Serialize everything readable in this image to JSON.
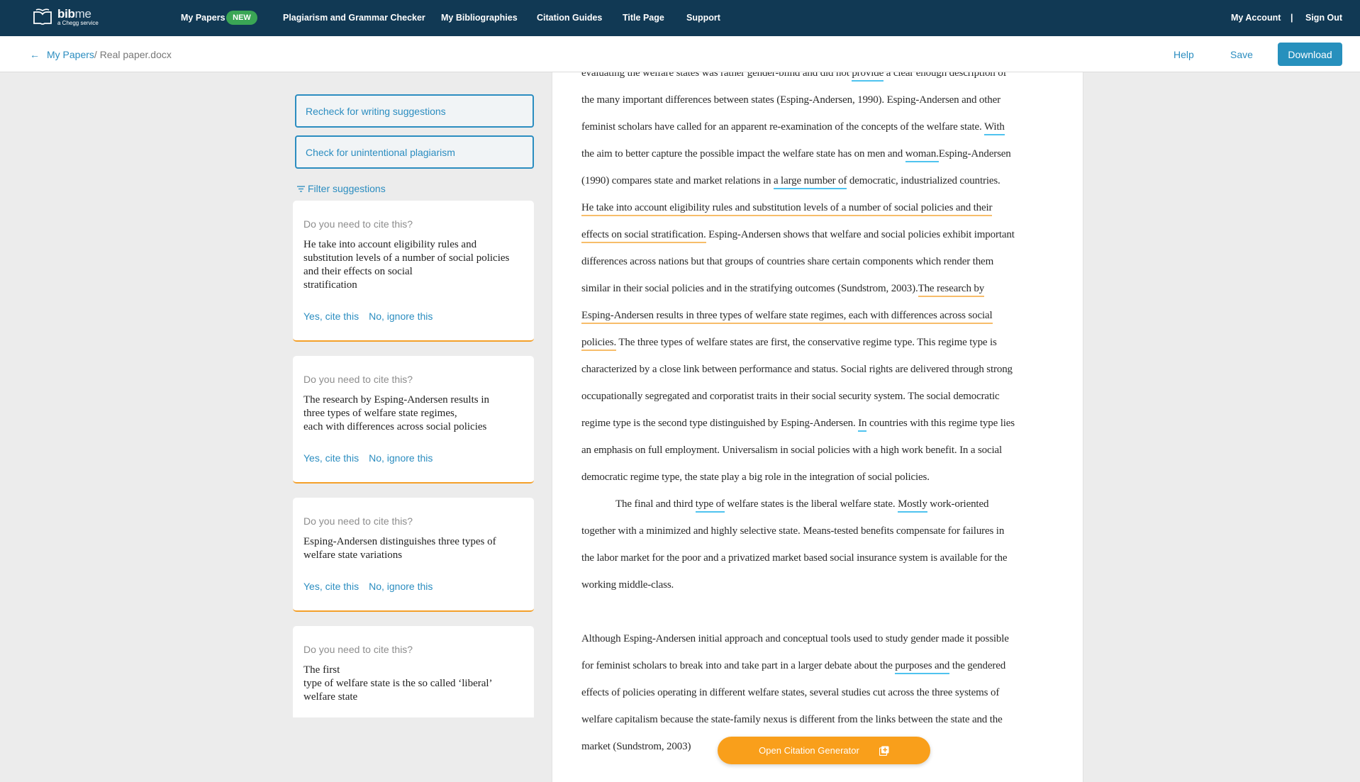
{
  "app": {
    "logo": {
      "name_bold": "bib",
      "name_light": "me",
      "tagline": "a Chegg service"
    },
    "nav": [
      {
        "label": "My Papers",
        "badge": "NEW"
      },
      {
        "label": "Plagiarism and Grammar Checker"
      },
      {
        "label": "My Bibliographies"
      },
      {
        "label": "Citation Guides"
      },
      {
        "label": "Title Page"
      },
      {
        "label": "Support"
      }
    ],
    "account": {
      "my_account": "My Account",
      "separator": "|",
      "sign_out": "Sign Out"
    }
  },
  "subheader": {
    "back_arrow": "←",
    "breadcrumb_link": "My Papers",
    "breadcrumb_current": "/ Real paper.docx",
    "help": "Help",
    "save": "Save",
    "download": "Download"
  },
  "sidebar": {
    "recheck_button": "Recheck for writing suggestions",
    "plagiarism_button": "Check for unintentional plagiarism",
    "filter_label": "Filter suggestions",
    "cards": [
      {
        "question": "Do you need to cite this?",
        "quote": "He take into account eligibility rules and\nsubstitution levels of a number of social policies\nand their effects on social\nstratification",
        "yes": "Yes, cite this",
        "no": "No, ignore this"
      },
      {
        "question": "Do you need to cite this?",
        "quote": "The research by Esping-Andersen results in\nthree types of welfare state regimes,\neach with differences across social policies",
        "yes": "Yes, cite this",
        "no": "No, ignore this"
      },
      {
        "question": "Do you need to cite this?",
        "quote": "Esping-Andersen distinguishes three types of\nwelfare state variations",
        "yes": "Yes, cite this",
        "no": "No, ignore this"
      },
      {
        "question": "Do you need to cite this?",
        "quote": "The first\ntype of welfare state is the so called ‘liberal’\nwelfare state"
      }
    ]
  },
  "document": {
    "lines": [
      {
        "segments": [
          {
            "t": "evaluating the welfare states was rather gender-blind and did not "
          },
          {
            "t": "provide",
            "u": "blue"
          },
          {
            "t": " a clear enough description of"
          }
        ]
      },
      {
        "segments": [
          {
            "t": "the many important differences between states (Esping-Andersen, 1990). Esping-Andersen and other"
          }
        ]
      },
      {
        "segments": [
          {
            "t": "feminist scholars have called for an apparent re-examination of the concepts of the welfare state. "
          },
          {
            "t": "With",
            "u": "blue"
          }
        ]
      },
      {
        "segments": [
          {
            "t": "the aim to better capture the possible impact the welfare state has on men and "
          },
          {
            "t": "woman.",
            "u": "blue"
          },
          {
            "t": "Esping-Andersen"
          }
        ]
      },
      {
        "segments": [
          {
            "t": "(1990) compares state and market relations in "
          },
          {
            "t": "a large number of",
            "u": "blue"
          },
          {
            "t": " democratic, industrialized countries."
          }
        ]
      },
      {
        "segments": [
          {
            "t": "He take into account eligibility rules and substitution levels of a number of social policies and their ",
            "u": "orange"
          }
        ]
      },
      {
        "segments": [
          {
            "t": "effects on social stratification.",
            "u": "orange"
          },
          {
            "t": " Esping-Andersen shows that welfare and social policies exhibit important"
          }
        ]
      },
      {
        "segments": [
          {
            "t": "differences across nations but that groups of countries share certain components which render them"
          }
        ]
      },
      {
        "segments": [
          {
            "t": "similar in their social policies and in the stratifying outcomes (Sundstrom, 2003)."
          },
          {
            "t": "The research by ",
            "u": "orange"
          }
        ]
      },
      {
        "segments": [
          {
            "t": "Esping-Andersen results in three types of welfare state regimes, each with differences across social ",
            "u": "orange"
          }
        ]
      },
      {
        "segments": [
          {
            "t": "policies.",
            "u": "orange"
          },
          {
            "t": " The three types of welfare states are first, the conservative regime type. This regime type is"
          }
        ]
      },
      {
        "segments": [
          {
            "t": "characterized by a close link between performance and status. Social rights are delivered through strong"
          }
        ]
      },
      {
        "segments": [
          {
            "t": "occupationally segregated and corporatist traits in their social security system. The social democratic"
          }
        ]
      },
      {
        "segments": [
          {
            "t": "regime type is the second type distinguished by Esping-Andersen. "
          },
          {
            "t": "In",
            "u": "blue"
          },
          {
            "t": " countries with this regime type lies"
          }
        ]
      },
      {
        "segments": [
          {
            "t": "an emphasis on full employment. Universalism in social policies with a high work benefit. In a social"
          }
        ]
      },
      {
        "segments": [
          {
            "t": "democratic regime type, the state play a big role in the integration of social policies."
          }
        ]
      },
      {
        "indent": true,
        "segments": [
          {
            "t": "The final and third "
          },
          {
            "t": "type of",
            "u": "blue"
          },
          {
            "t": " welfare states is the liberal welfare state. "
          },
          {
            "t": "Mostly",
            "u": "blue"
          },
          {
            "t": " work-oriented"
          }
        ]
      },
      {
        "segments": [
          {
            "t": "together with a minimized and highly selective state. Means-tested benefits compensate for failures in"
          }
        ]
      },
      {
        "segments": [
          {
            "t": "the labor market for the poor and a privatized market based social insurance system is available for the"
          }
        ]
      },
      {
        "segments": [
          {
            "t": "working middle-class."
          }
        ]
      },
      {
        "gap": true
      },
      {
        "segments": [
          {
            "t": "Although Esping-Andersen initial approach and conceptual tools used to study gender made it possible"
          }
        ]
      },
      {
        "segments": [
          {
            "t": "for feminist scholars to break into and take part in a larger debate about the "
          },
          {
            "t": "purposes and",
            "u": "blue"
          },
          {
            "t": " the gendered"
          }
        ]
      },
      {
        "segments": [
          {
            "t": "effects of policies operating in different welfare states, several studies cut across the three systems of"
          }
        ]
      },
      {
        "segments": [
          {
            "t": "welfare capitalism because the state-family nexus is different from the links between the state and the"
          }
        ]
      },
      {
        "segments": [
          {
            "t": "market (Sundstrom, 2003)"
          }
        ]
      }
    ]
  },
  "citation_generator": {
    "label": "Open Citation Generator",
    "icon": "add-copy-icon"
  },
  "colors": {
    "header_bg": "#113954",
    "accent_blue": "#2b8dc0",
    "download_bg": "#2790bd",
    "badge_green": "#3aa655",
    "orange": "#f99f1b",
    "underline_blue": "#4fc3ef",
    "underline_orange": "#f7bd6a"
  }
}
